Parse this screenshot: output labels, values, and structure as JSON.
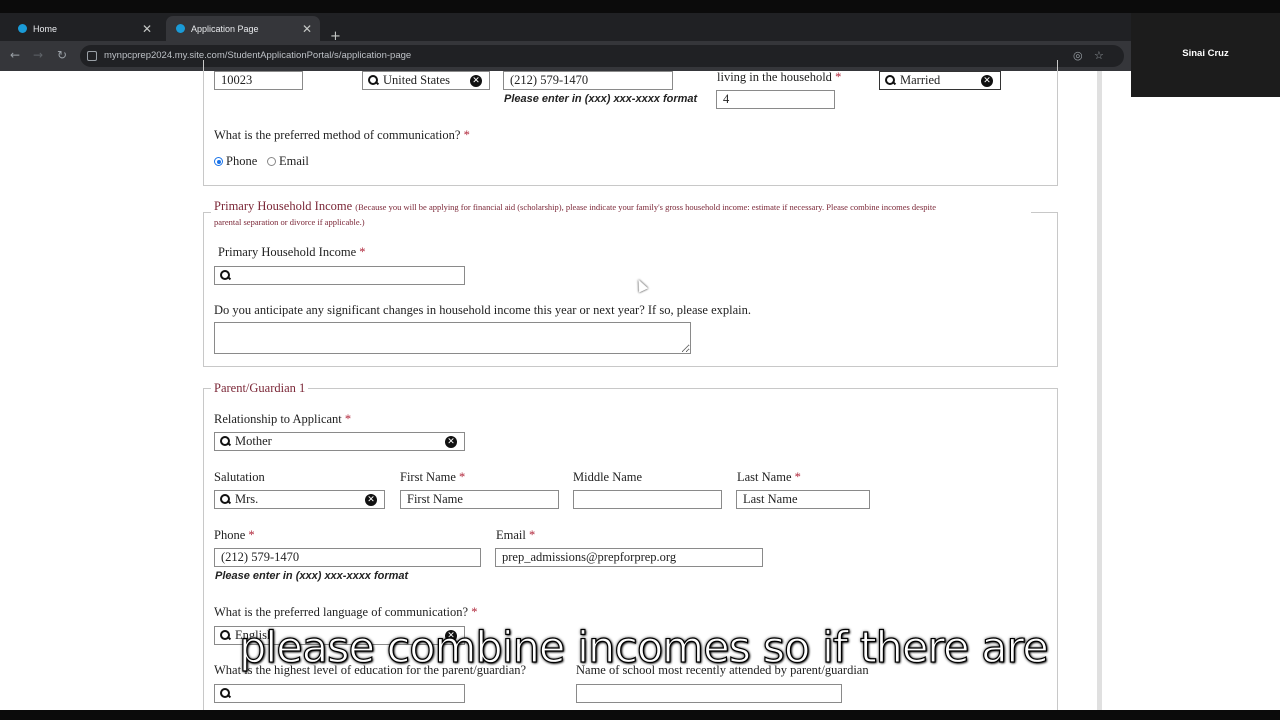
{
  "browser": {
    "tabs": [
      {
        "label": "Home"
      },
      {
        "label": "Application Page"
      }
    ],
    "url": "mynpcprep2024.my.site.com/StudentApplicationPortal/s/application-page",
    "webcam_name": "Sinai Cruz"
  },
  "top_row": {
    "zip": "10023",
    "country": "United States",
    "phone": "(212) 579-1470",
    "phone_hint": "Please enter in (xxx) xxx-xxxx format",
    "household_label": "living in the household",
    "household_value": "4",
    "marital_status": "Married"
  },
  "communication": {
    "question": "What is the preferred method of communication?",
    "options": [
      "Phone",
      "Email"
    ],
    "selected": "Phone"
  },
  "income": {
    "legend": "Primary Household Income",
    "legend_note_line1": "(Because you will be applying for financial aid (scholarship), please indicate your family's gross household income: estimate if necessary. Please combine incomes despite",
    "legend_note_line2": "parental separation or divorce if applicable.)",
    "field_label": "Primary Household Income",
    "field_value": "",
    "changes_question": "Do you anticipate any significant changes in household income this year or next year? If so, please explain.",
    "changes_value": ""
  },
  "guardian": {
    "legend": "Parent/Guardian 1",
    "relationship_label": "Relationship to Applicant",
    "relationship_value": "Mother",
    "salutation_label": "Salutation",
    "salutation_value": "Mrs.",
    "first_name_label": "First Name",
    "first_name_placeholder": "First Name",
    "middle_name_label": "Middle Name",
    "middle_name_value": "",
    "last_name_label": "Last Name",
    "last_name_placeholder": "Last Name",
    "phone_label": "Phone",
    "phone_value": "(212) 579-1470",
    "phone_hint": "Please enter in (xxx) xxx-xxxx format",
    "email_label": "Email",
    "email_value": "prep_admissions@prepforprep.org",
    "language_question": "What is the preferred language of communication?",
    "language_value": "English",
    "education_question": "What is the highest level of education for the parent/guardian?",
    "education_value": "",
    "school_label": "Name of school most recently attended by parent/guardian",
    "school_value": ""
  },
  "required_marker": "*",
  "caption": "please combine incomes so if there are",
  "colors": {
    "legend": "#7b2737",
    "required": "#b0263a",
    "radio_selected": "#1a73e8"
  },
  "icons": {
    "search": "search-icon",
    "clear": "clear-icon"
  }
}
